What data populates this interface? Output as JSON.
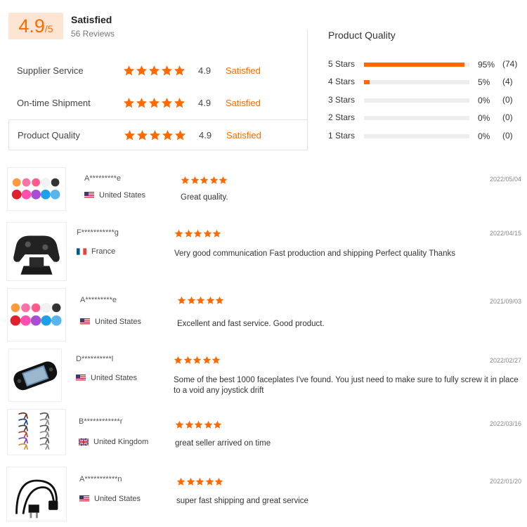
{
  "summary": {
    "score": "4.9",
    "score_den": "/5",
    "title": "Satisfied",
    "reviews": "56 Reviews"
  },
  "ratings": [
    {
      "label": "Supplier Service",
      "score": "4.9",
      "word": "Satisfied",
      "stars": 5
    },
    {
      "label": "On-time Shipment",
      "score": "4.9",
      "word": "Satisfied",
      "stars": 5
    },
    {
      "label": "Product Quality",
      "score": "4.9",
      "word": "Satisfied",
      "stars": 5
    }
  ],
  "breakdown": {
    "title": "Product Quality",
    "rows": [
      {
        "label": "5 Stars",
        "fraction": 0.95,
        "pct": "95%",
        "count": "(74)"
      },
      {
        "label": "4 Stars",
        "fraction": 0.05,
        "pct": "5%",
        "count": "(4)"
      },
      {
        "label": "3 Stars",
        "fraction": 0,
        "pct": "0%",
        "count": "(0)"
      },
      {
        "label": "2 Stars",
        "fraction": 0,
        "pct": "0%",
        "count": "(0)"
      },
      {
        "label": "1 Stars",
        "fraction": 0,
        "pct": "0%",
        "count": "(0)"
      }
    ]
  },
  "colors": {
    "accent": "#ff6a00",
    "accent_bg": "#fde5d4"
  },
  "reviews": [
    {
      "name": "A*********e",
      "country": "United States",
      "flag": "us-flag-icon",
      "text": "Great quality.",
      "date": "2022/05/04",
      "stars": 5,
      "thumb": "thumbstick-caps-image"
    },
    {
      "name": "F***********g",
      "country": "France",
      "flag": "france-flag-icon",
      "text": "Very good communication Fast production and shipping Perfect quality Thanks",
      "date": "2022/04/15",
      "stars": 5,
      "thumb": "controller-stand-image"
    },
    {
      "name": "A*********e",
      "country": "United States",
      "flag": "us-flag-icon",
      "text": "Excellent and fast service. Good product.",
      "date": "2021/09/03",
      "stars": 5,
      "thumb": "thumbstick-caps-image"
    },
    {
      "name": "D**********l",
      "country": "United States",
      "flag": "us-flag-icon",
      "text": "Some of the best 1000 faceplates I've found. You just need to make sure to fully screw it in place to a void any joystick drift",
      "date": "2022/02/27",
      "stars": 5,
      "thumb": "handheld-faceplate-image"
    },
    {
      "name": "B************r",
      "country": "United Kingdom",
      "flag": "uk-flag-icon",
      "text": "great seller arrived on time",
      "date": "2022/03/16",
      "stars": 5,
      "thumb": "trigger-brackets-image"
    },
    {
      "name": "A***********n",
      "country": "United States",
      "flag": "us-flag-icon",
      "text": "super fast shipping and great service",
      "date": "2022/01/20",
      "stars": 5,
      "thumb": "power-cable-image"
    }
  ]
}
